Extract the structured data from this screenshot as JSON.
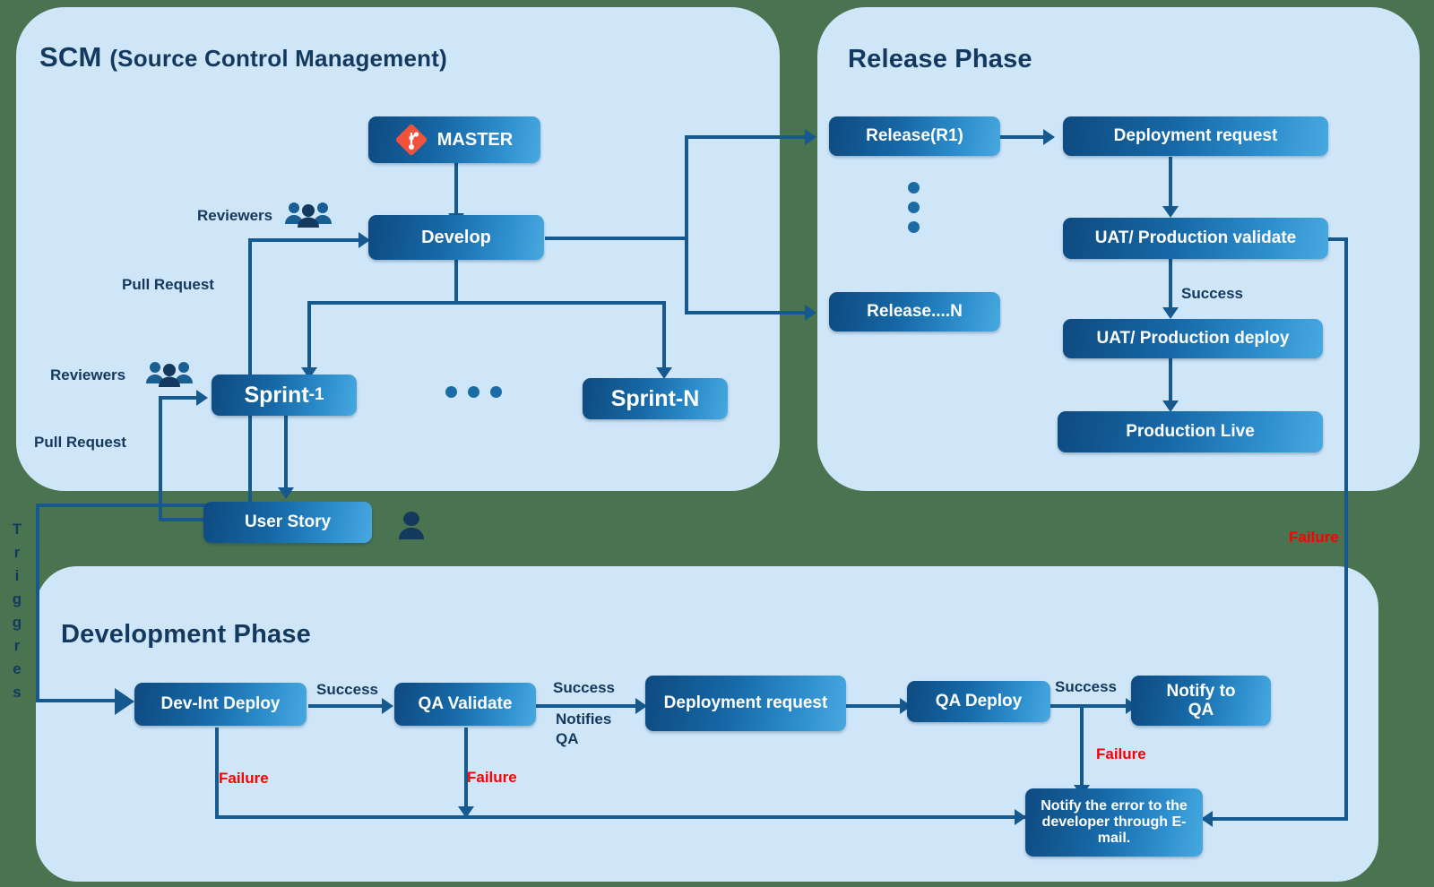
{
  "panels": {
    "scm": {
      "title_main": "SCM ",
      "title_paren": "(Source Control Management)"
    },
    "release": {
      "title": "Release Phase"
    },
    "development": {
      "title": "Development Phase"
    }
  },
  "scm": {
    "master": {
      "label": "MASTER",
      "icon": "git-icon"
    },
    "develop": {
      "label": "Develop"
    },
    "sprint_1": {
      "label": "Sprint",
      "suffix": "-1"
    },
    "sprint_n": {
      "label": "Sprint-N"
    },
    "user_story": {
      "label": "User Story"
    },
    "labels": {
      "reviewers_top": "Reviewers",
      "pull_request_top": "Pull Request",
      "reviewers_bottom": "Reviewers",
      "pull_request_bottom": "Pull Request"
    },
    "ellipsis_dots": 3
  },
  "release": {
    "release_r1": {
      "label": "Release ",
      "suffix": "(R1)"
    },
    "release_n": {
      "label": "Release....N"
    },
    "deployment_request": {
      "label": "Deployment request"
    },
    "uat_validate": {
      "label": "UAT/ Production validate"
    },
    "uat_deploy": {
      "label": "UAT/ Production deploy"
    },
    "production_live": {
      "label": "Production Live"
    },
    "labels": {
      "success": "Success",
      "failure": "Failure"
    },
    "vertical_dots": 3
  },
  "development": {
    "dev_int_deploy": {
      "label": "Dev-Int Deploy"
    },
    "qa_validate": {
      "label": "QA Validate"
    },
    "deployment_request": {
      "label": "Deployment request"
    },
    "qa_deploy": {
      "label": "QA Deploy"
    },
    "notify_qa": {
      "label": "Notify to QA"
    },
    "notify_error": {
      "label": "Notify the error to the developer through E-mail."
    },
    "labels": {
      "success_1": "Success",
      "success_2": "Success",
      "notifies_qa": "Notifies QA",
      "success_3": "Success",
      "failure_1": "Failure",
      "failure_2": "Failure",
      "failure_3": "Failure"
    }
  },
  "trigger": {
    "text": "Triggres",
    "letters": [
      "T",
      "r",
      "i",
      "g",
      "g",
      "r",
      "e",
      "s"
    ]
  },
  "colors": {
    "panel_bg": "#cfe6f9",
    "box_gradient_from": "#0e4a80",
    "box_gradient_to": "#48a9e0",
    "connector": "#15598f",
    "title": "#13395f",
    "failure": "#ff0000",
    "git_icon": "#f0523c",
    "canvas_bg": "#4a7450"
  }
}
